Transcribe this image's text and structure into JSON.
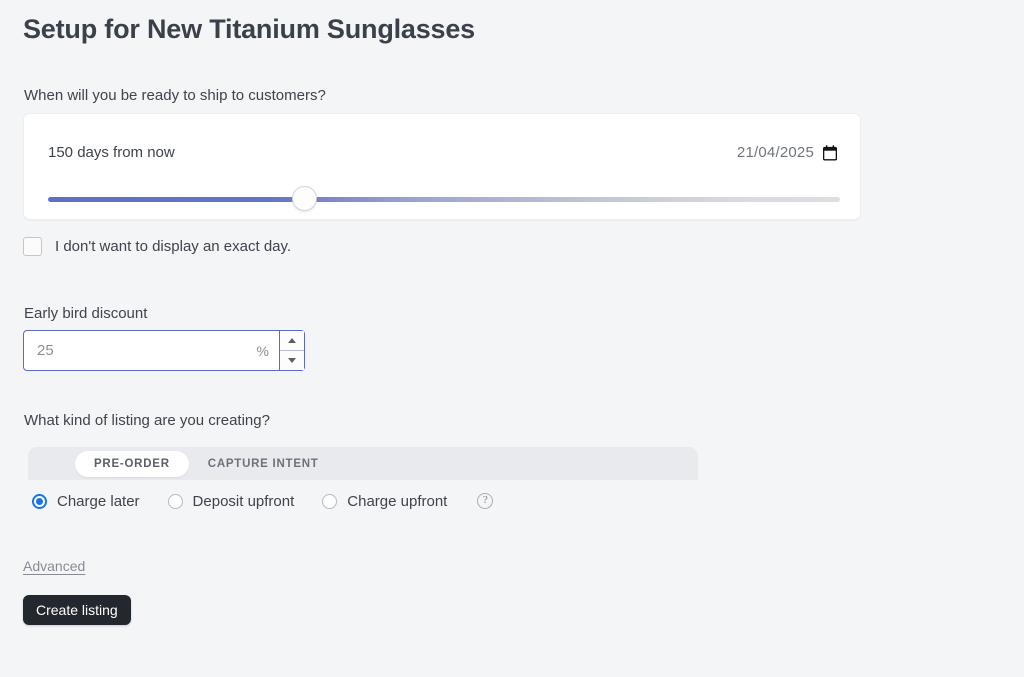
{
  "page": {
    "title": "Setup for New Titanium Sunglasses"
  },
  "ship": {
    "question": "When will you be ready to ship to customers?",
    "days_text": "150 days from now",
    "date_value": "21/04/2025",
    "calendar_icon": "calendar-icon",
    "slider": {
      "position_percent": 31,
      "filled_color": "#5f6fc6",
      "track_color": "#dcdee2"
    }
  },
  "exact_day": {
    "checkbox_label": "I don't want to display an exact day.",
    "checked": false
  },
  "discount": {
    "label": "Early bird discount",
    "value": "25",
    "placeholder": "25",
    "suffix": "%",
    "focus_color": "#5c6ac4",
    "stepper_up_icon": "triangle-up-icon",
    "stepper_down_icon": "triangle-down-icon"
  },
  "listing": {
    "question": "What kind of listing are you creating?",
    "tabs": [
      {
        "label": "PRE-ORDER",
        "active": true
      },
      {
        "label": "CAPTURE INTENT",
        "active": false
      }
    ],
    "charge_options": [
      {
        "label": "Charge later",
        "selected": true
      },
      {
        "label": "Deposit upfront",
        "selected": false
      },
      {
        "label": "Charge upfront",
        "selected": false
      }
    ],
    "help_icon": "help-circle-icon",
    "help_glyph": "?",
    "selected_color": "#1a73e8"
  },
  "footer": {
    "advanced_label": "Advanced",
    "create_label": "Create listing",
    "create_bg": "#23272e"
  }
}
